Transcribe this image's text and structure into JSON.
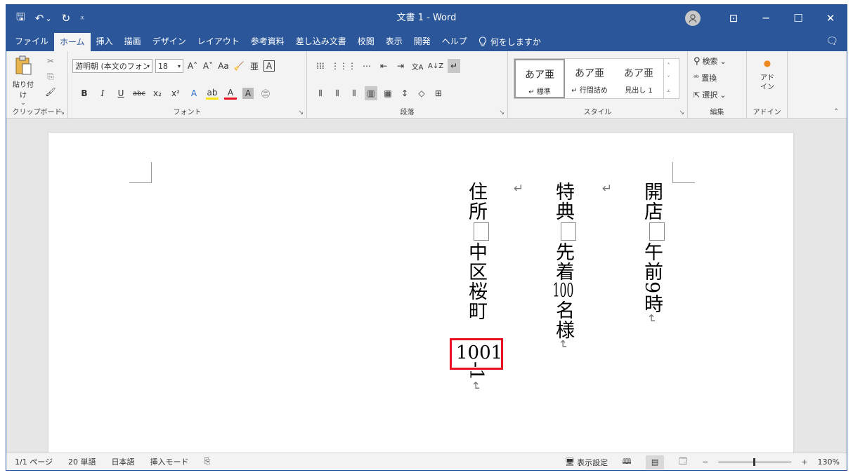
{
  "titlebar": {
    "title": "文書 1 - Word",
    "qat": {
      "save": "🖫",
      "undo": "↶",
      "undo_drop": "⌄",
      "redo": "↻",
      "customize": "⩡"
    },
    "ribbon_display": "⊡",
    "minimize": "─",
    "maximize": "☐",
    "close": "✕"
  },
  "menubar": {
    "items": [
      "ファイル",
      "ホーム",
      "挿入",
      "描画",
      "デザイン",
      "レイアウト",
      "参考資料",
      "差し込み文書",
      "校閲",
      "表示",
      "開発",
      "ヘルプ"
    ],
    "active": "ホーム",
    "tellme": "何をしますか",
    "comment_icon": "🗨"
  },
  "ribbon": {
    "clipboard": {
      "label": "クリップボード",
      "paste": "貼り付け",
      "paste_arrow": "⌄",
      "cut": "✂",
      "copy": "⎘",
      "format_painter": "🖌"
    },
    "font": {
      "label": "フォント",
      "font_name": "游明朝 (本文のフォン",
      "font_size": "18",
      "drop": "▾",
      "grow": "A˄",
      "shrink": "A˅",
      "change_case": "Aa",
      "clear": "🧹",
      "ruby": "亜",
      "border_char": "A",
      "bold": "B",
      "italic": "I",
      "underline": "U",
      "strike": "abc",
      "sub": "x₂",
      "sup": "x²",
      "effects": "A",
      "highlight": "ab",
      "font_color": "A",
      "shading": "A",
      "enclose": "㊁",
      "chev": "⌄"
    },
    "paragraph": {
      "label": "段落",
      "bullets": "⁞⁞⁞",
      "numbering": "⋮⋮⋮",
      "multilevel": "⋯",
      "dec_indent": "⇤",
      "inc_indent": "⇥",
      "direction": "文A",
      "sort": "A↓Z",
      "marks": "↵",
      "align_top": "⫴",
      "align_mid": "⫴",
      "align_bot": "⫴",
      "align_just": "▥",
      "align_dist": "▦",
      "spacing": "↕",
      "shade": "◇",
      "borders": "⊞",
      "chev": "⌄"
    },
    "styles": {
      "label": "スタイル",
      "items": [
        {
          "sample": "あア亜",
          "name": "↵ 標準"
        },
        {
          "sample": "あア亜",
          "name": "↵ 行間詰め"
        },
        {
          "sample": "あア亜",
          "name": "見出し 1"
        }
      ],
      "scroll_up": "˄",
      "scroll_down": "˅",
      "more": "⩡"
    },
    "editing": {
      "label": "編集",
      "find": "検索",
      "replace": "置換",
      "select": "選択",
      "chev": "⌄",
      "find_icon": "⚲",
      "replace_icon": "ᵃᵇ",
      "select_icon": "⇱"
    },
    "addin": {
      "label": "アドイン",
      "btn": "アド\nイン",
      "icon": "●"
    },
    "launcher": "↘",
    "collapse": "˄"
  },
  "document": {
    "col1": {
      "chars_before": "開店",
      "chars_after": "午前9時",
      "mark": "↵"
    },
    "col2": {
      "chars_before": "特典",
      "chars_mid": "先着",
      "num": "100",
      "chars_after": "名様",
      "mark": "↵"
    },
    "col3": {
      "chars_before": "住所",
      "chars_mid": "中区桜町",
      "highlight_num": "1001",
      "chars_after": "-1",
      "mark": "↵"
    },
    "floating_marks": [
      "↵",
      "↵"
    ]
  },
  "statusbar": {
    "page": "1/1 ページ",
    "words": "20 単語",
    "lang": "日本語",
    "mode": "挿入モード",
    "macro_icon": "⎘",
    "display_settings": "表示設定",
    "display_icon": "🖥",
    "view_read": "🕮",
    "view_print": "▤",
    "view_web": "🗔",
    "zoom_minus": "−",
    "zoom_plus": "+",
    "zoom": "130%"
  },
  "colors": {
    "accent": "#2b579a",
    "highlight": "#e8121f",
    "ribbon": "#f3f3f3",
    "workspace": "#e6e6e6"
  }
}
